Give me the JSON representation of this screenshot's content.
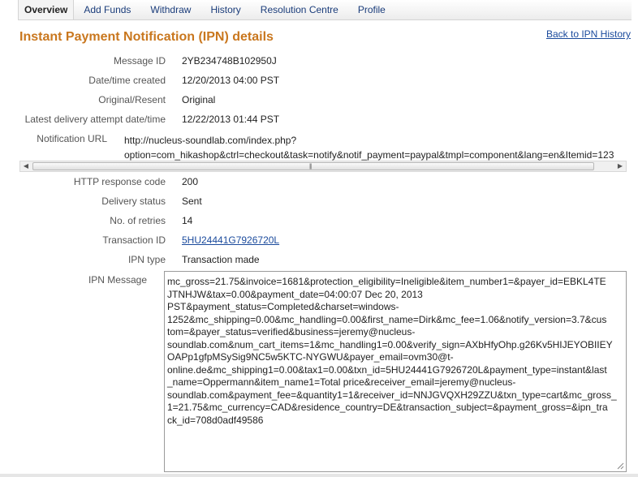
{
  "nav": {
    "items": [
      "Overview",
      "Add Funds",
      "Withdraw",
      "History",
      "Resolution Centre",
      "Profile"
    ]
  },
  "page": {
    "title": "Instant Payment Notification (IPN) details",
    "back_link": "Back to IPN History"
  },
  "fields": {
    "message_id": {
      "label": "Message ID",
      "value": "2YB234748B102950J"
    },
    "created": {
      "label": "Date/time created",
      "value": "12/20/2013 04:00 PST"
    },
    "original": {
      "label": "Original/Resent",
      "value": "Original"
    },
    "latest": {
      "label": "Latest delivery attempt date/time",
      "value": "12/22/2013 01:44 PST"
    },
    "http_code": {
      "label": "HTTP response code",
      "value": "200"
    },
    "status": {
      "label": "Delivery status",
      "value": "Sent"
    },
    "retries": {
      "label": "No. of retries",
      "value": "14"
    },
    "txn_id": {
      "label": "Transaction ID",
      "value": "5HU24441G7926720L"
    },
    "ipn_type": {
      "label": "IPN type",
      "value": "Transaction made"
    }
  },
  "notification_url": {
    "label": "Notification URL",
    "line1": "http://nucleus-soundlab.com/index.php?",
    "line2": "option=com_hikashop&ctrl=checkout&task=notify&notif_payment=paypal&tmpl=component&lang=en&Itemid=123"
  },
  "ipn_message": {
    "label": "IPN Message",
    "lines": [
      "mc_gross=21.75&invoice=1681&protection_eligibility=Ineligible&item_number1=&payer_id=EBKL4TE",
      "JTNHJW&tax=0.00&payment_date=04:00:07 Dec 20, 2013",
      "PST&payment_status=Completed&charset=windows-",
      "1252&mc_shipping=0.00&mc_handling=0.00&first_name=Dirk&mc_fee=1.06&notify_version=3.7&cus",
      "tom=&payer_status=verified&business=jeremy@nucleus-",
      "soundlab.com&num_cart_items=1&mc_handling1=0.00&verify_sign=AXbHfyOhp.g26Kv5HIJEYOBIIEY",
      "OAPp1gfpMSySig9NC5w5KTC-NYGWU&payer_email=ovm30@t-",
      "online.de&mc_shipping1=0.00&tax1=0.00&txn_id=5HU24441G7926720L&payment_type=instant&last",
      "_name=Oppermann&item_name1=Total price&receiver_email=jeremy@nucleus-",
      "soundlab.com&payment_fee=&quantity1=1&receiver_id=NNJGVQXH29ZZU&txn_type=cart&mc_gross_",
      "1=21.75&mc_currency=CAD&residence_country=DE&transaction_subject=&payment_gross=&ipn_tra",
      "ck_id=708d0adf49586"
    ]
  },
  "icons": {
    "scroll_left": "triangle-left-icon",
    "scroll_right": "triangle-right-icon",
    "resize": "resize-grip-icon"
  }
}
